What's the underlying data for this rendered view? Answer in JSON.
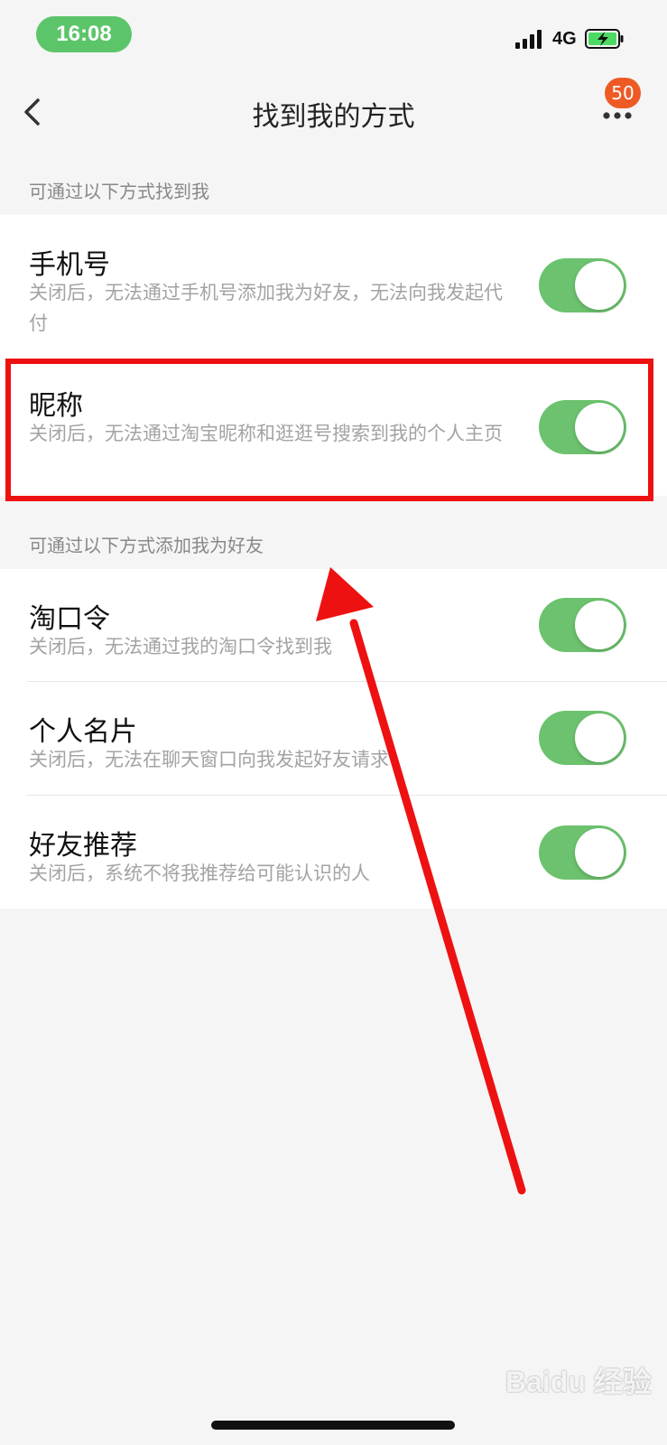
{
  "status_bar": {
    "time": "16:08",
    "network": "4G",
    "icons": [
      "signal-icon",
      "battery-charging-icon"
    ]
  },
  "nav": {
    "title": "找到我的方式",
    "badge_count": "50",
    "icons": [
      "back-icon",
      "more-icon"
    ]
  },
  "sections": [
    {
      "header": "可通过以下方式找到我",
      "items": [
        {
          "title": "手机号",
          "desc": "关闭后，无法通过手机号添加我为好友，无法向我发起代付",
          "enabled": true
        },
        {
          "title": "昵称",
          "desc": "关闭后，无法通过淘宝昵称和逛逛号搜索到我的个人主页",
          "enabled": true
        }
      ]
    },
    {
      "header": "可通过以下方式添加我为好友",
      "items": [
        {
          "title": "淘口令",
          "desc": "关闭后，无法通过我的淘口令找到我",
          "enabled": true
        },
        {
          "title": "个人名片",
          "desc": "关闭后，无法在聊天窗口向我发起好友请求",
          "enabled": true
        },
        {
          "title": "好友推荐",
          "desc": "关闭后，系统不将我推荐给可能认识的人",
          "enabled": true
        }
      ]
    }
  ],
  "colors": {
    "toggle_on": "#6cc26e",
    "highlight": "#ee1111",
    "arrow": "#ee1111",
    "badge": "#ee5a24",
    "time_pill": "#5cc56a"
  },
  "watermark": {
    "text": "Baidu 经验"
  }
}
